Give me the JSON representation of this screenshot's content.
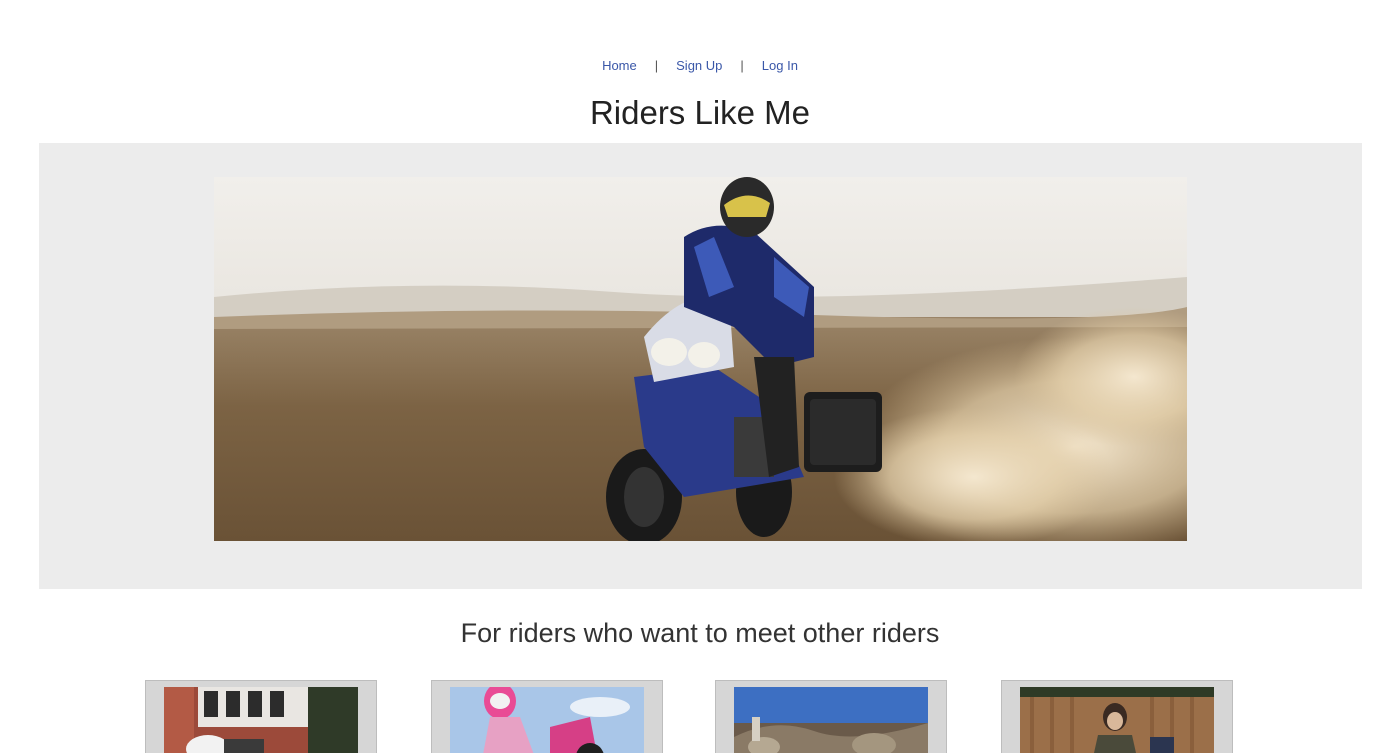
{
  "nav": {
    "items": [
      {
        "label": "Home"
      },
      {
        "label": "Sign Up"
      },
      {
        "label": "Log In"
      }
    ],
    "separator": "|"
  },
  "header": {
    "title": "Riders Like Me"
  },
  "hero": {
    "image": "motorcycle-rider-desert-photo"
  },
  "tagline": "For riders who want to meet other riders",
  "thumbnails": [
    {
      "image": "rider-house-photo"
    },
    {
      "image": "pink-rider-photo"
    },
    {
      "image": "rocky-landscape-photo"
    },
    {
      "image": "rider-fence-photo"
    }
  ],
  "colors": {
    "link": "#3a57a8",
    "hero_bg": "#ececec",
    "thumb_frame": "#d6d6d6"
  }
}
